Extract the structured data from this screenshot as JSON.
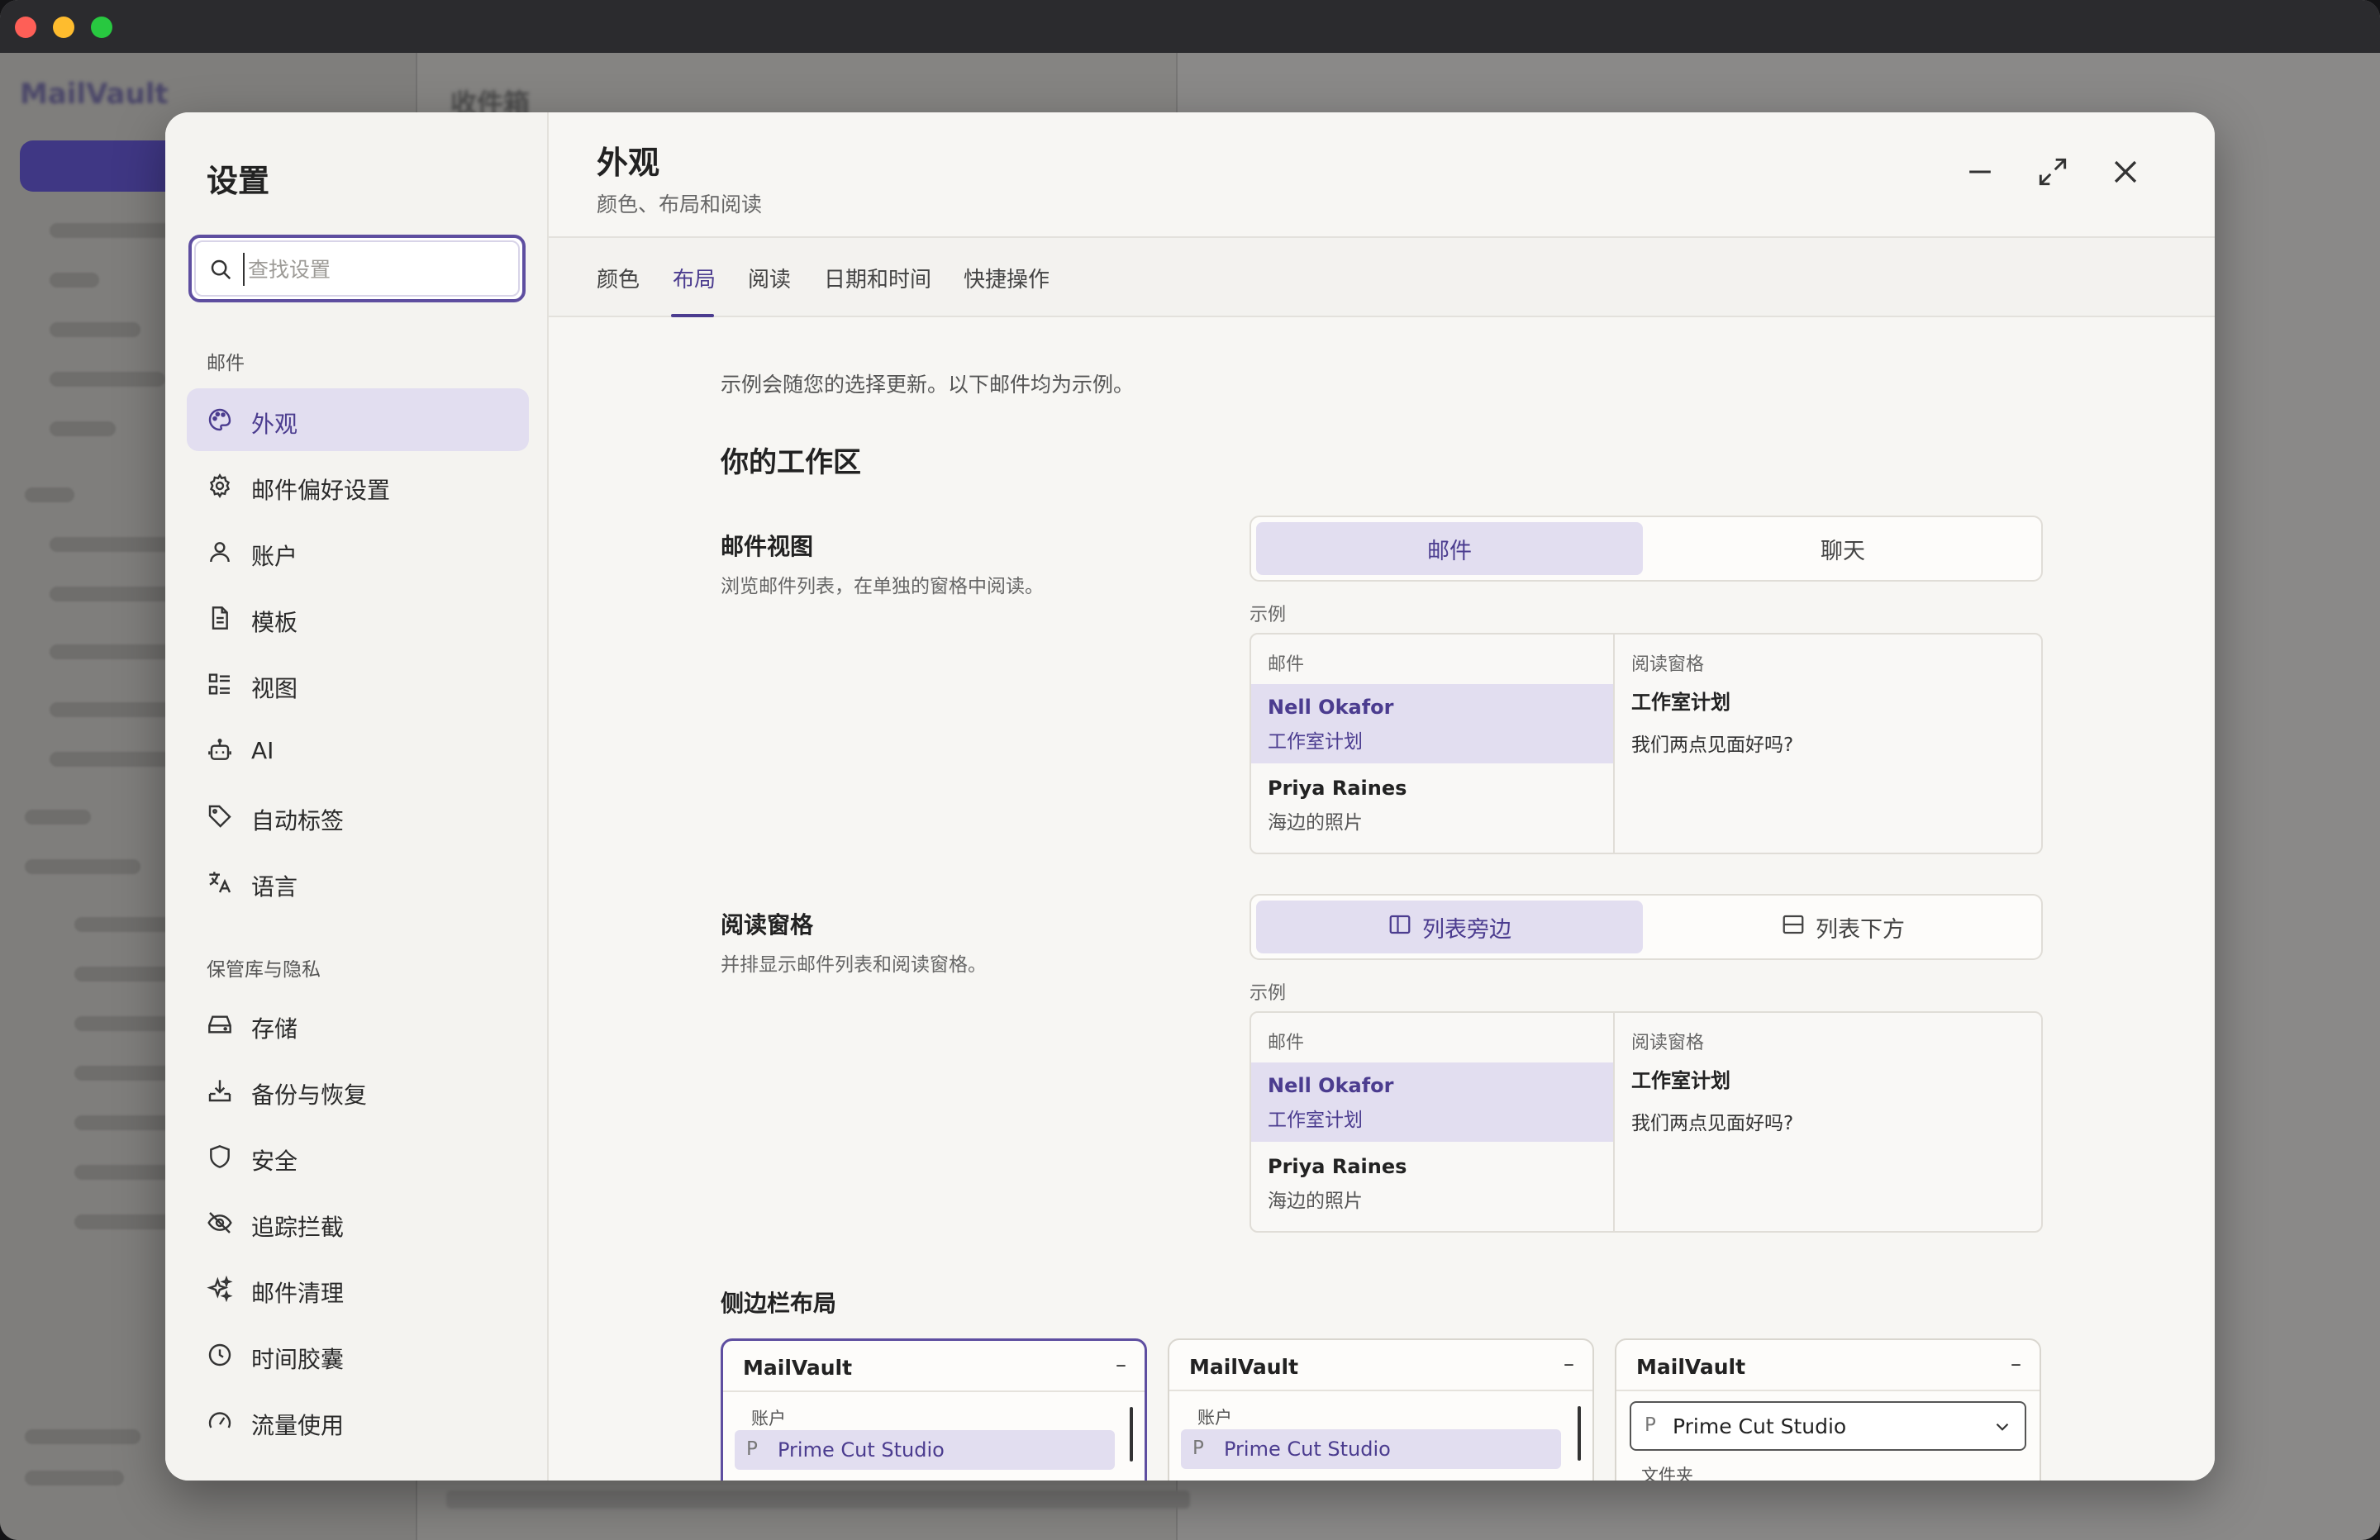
{
  "background_app": {
    "logo": "MailVault",
    "title": "收件箱"
  },
  "settings": {
    "title": "设置",
    "search_placeholder": "查找设置",
    "section_mail": "邮件",
    "section_vault": "保管库与隐私",
    "nav_mail": [
      {
        "label": "外观",
        "icon": "palette-icon",
        "active": true
      },
      {
        "label": "邮件偏好设置",
        "icon": "gear-icon"
      },
      {
        "label": "账户",
        "icon": "person-icon"
      },
      {
        "label": "模板",
        "icon": "document-icon"
      },
      {
        "label": "视图",
        "icon": "list-view-icon"
      },
      {
        "label": "AI",
        "icon": "robot-icon"
      },
      {
        "label": "自动标签",
        "icon": "tag-icon"
      },
      {
        "label": "语言",
        "icon": "translate-icon"
      }
    ],
    "nav_vault": [
      {
        "label": "存储",
        "icon": "drive-icon"
      },
      {
        "label": "备份与恢复",
        "icon": "download-tray-icon"
      },
      {
        "label": "安全",
        "icon": "shield-icon"
      },
      {
        "label": "追踪拦截",
        "icon": "eye-off-icon"
      },
      {
        "label": "邮件清理",
        "icon": "sparkle-icon"
      },
      {
        "label": "时间胶囊",
        "icon": "clock-icon"
      },
      {
        "label": "流量使用",
        "icon": "gauge-icon"
      }
    ]
  },
  "header": {
    "title": "外观",
    "subtitle": "颜色、布局和阅读"
  },
  "tabs": [
    "颜色",
    "布局",
    "阅读",
    "日期和时间",
    "快捷操作"
  ],
  "active_tab": "布局",
  "content": {
    "intro": "示例会随您的选择更新。以下邮件均为示例。",
    "workspace_heading": "你的工作区",
    "mail_view": {
      "title": "邮件视图",
      "desc": "浏览邮件列表，在单独的窗格中阅读。",
      "options": [
        "邮件",
        "聊天"
      ],
      "selected": "邮件"
    },
    "reading_pane": {
      "title": "阅读窗格",
      "desc": "并排显示邮件列表和阅读窗格。",
      "options": [
        "列表旁边",
        "列表下方"
      ],
      "selected": "列表旁边"
    },
    "example": {
      "label": "示例",
      "list_head": "邮件",
      "pane_head": "阅读窗格",
      "messages": [
        {
          "name": "Nell Okafor",
          "subject": "工作室计划"
        },
        {
          "name": "Priya Raines",
          "subject": "海边的照片"
        }
      ],
      "pane_title": "工作室计划",
      "pane_body": "我们两点见面好吗?"
    },
    "sidebar_layout": {
      "title": "侧边栏布局",
      "app_name": "MailVault",
      "minus": "–",
      "accounts_label": "账户",
      "account_initial": "P",
      "account_name": "Prime Cut Studio",
      "folders_label": "文件夹"
    }
  },
  "colors": {
    "accent": "#4b3c8f",
    "accent_soft": "#e2def0"
  }
}
